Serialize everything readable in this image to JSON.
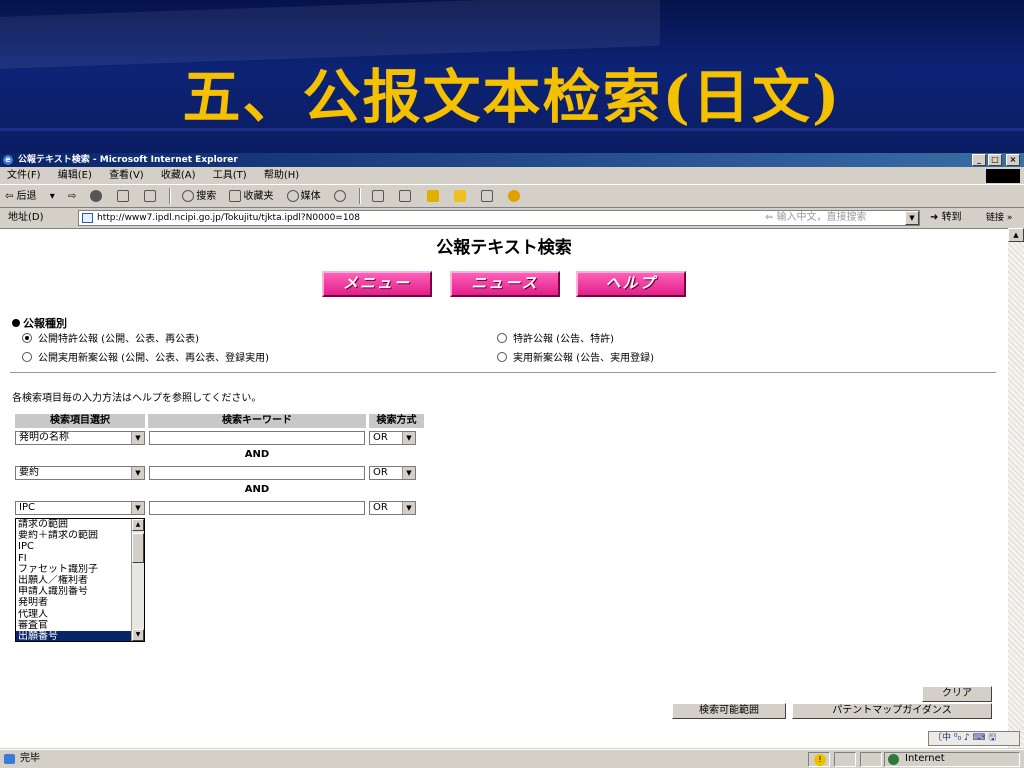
{
  "slide": {
    "title": "五、公报文本检索(日文)"
  },
  "window": {
    "title": "公報テキスト検索 - Microsoft Internet Explorer",
    "controls": {
      "minimize": "_",
      "maximize": "□",
      "close": "×"
    }
  },
  "menu": [
    "文件(F)",
    "编辑(E)",
    "查看(V)",
    "收藏(A)",
    "工具(T)",
    "帮助(H)"
  ],
  "toolbar": {
    "back": "⇦ 后退",
    "forward": "⇨",
    "search": "搜索",
    "favorites": "收藏夹",
    "media": "媒体"
  },
  "address": {
    "label": "地址(D)",
    "url": "http://www7.ipdl.ncipi.go.jp/Tokujitu/tjkta.ipdl?N0000=108",
    "hint": "⇐ 输入中文，直接搜索",
    "go": "转到",
    "links": "链接 »"
  },
  "page": {
    "heading": "公報テキスト検索",
    "nav": {
      "menu": "メニュー",
      "news": "ニュース",
      "help": "ヘルプ"
    },
    "kind_label": "公報種別",
    "radios": [
      {
        "label": "公開特許公報 (公開、公表、再公表)",
        "checked": true
      },
      {
        "label": "特許公報 (公告、特許)",
        "checked": false
      },
      {
        "label": "公開実用新案公報 (公開、公表、再公表、登録実用)",
        "checked": false
      },
      {
        "label": "実用新案公報 (公告、実用登録)",
        "checked": false
      }
    ],
    "instruction": "各検索項目毎の入力方法はヘルプを参照してください。",
    "table": {
      "headers": [
        "検索項目選択",
        "検索キーワード",
        "検索方式"
      ],
      "rows": [
        {
          "field": "発明の名称",
          "keyword": "",
          "mode": "OR"
        },
        {
          "field": "要約",
          "keyword": "",
          "mode": "OR"
        },
        {
          "field": "IPC",
          "keyword": "",
          "mode": "OR"
        }
      ],
      "connector": "AND"
    },
    "dropdown_options": [
      "請求の範囲",
      "要約＋請求の範囲",
      "IPC",
      "FI",
      "ファセット識別子",
      "出願人／権利者",
      "申請人識別番号",
      "発明者",
      "代理人",
      "審査官",
      "出願番号"
    ],
    "buttons": {
      "clear": "クリア",
      "searchable_range": "検索可能範囲",
      "patent_map": "パテントマップガイダンス"
    }
  },
  "langbar": "〔中 ⁰₀ ♪ ⌨ 🖫",
  "status": {
    "text": "完毕",
    "zone": "Internet"
  }
}
